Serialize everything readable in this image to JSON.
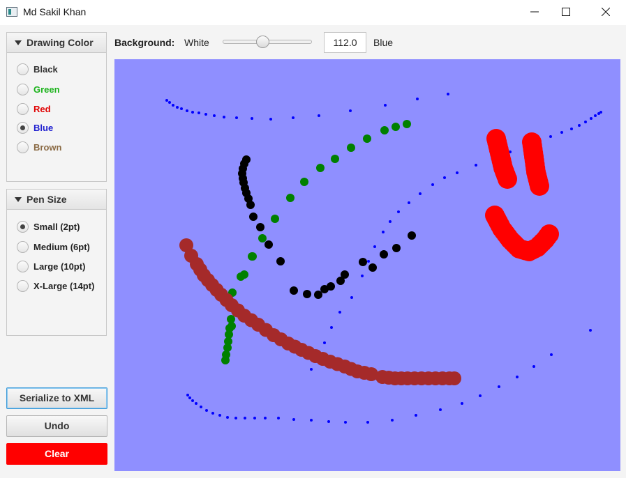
{
  "window": {
    "title": "Md Sakil Khan"
  },
  "color_panel": {
    "title": "Drawing Color",
    "options": [
      {
        "label": "Black",
        "color": "#333333",
        "selected": false
      },
      {
        "label": "Green",
        "color": "#1db31d",
        "selected": false
      },
      {
        "label": "Red",
        "color": "#e00000",
        "selected": false
      },
      {
        "label": "Blue",
        "color": "#2020d0",
        "selected": true
      },
      {
        "label": "Brown",
        "color": "#8a6a44",
        "selected": false
      }
    ]
  },
  "pen_panel": {
    "title": "Pen Size",
    "options": [
      {
        "label": "Small (2pt)",
        "selected": true
      },
      {
        "label": "Medium (6pt)",
        "selected": false
      },
      {
        "label": "Large (10pt)",
        "selected": false
      },
      {
        "label": "X-Large (14pt)",
        "selected": false
      }
    ]
  },
  "buttons": {
    "serialize": "Serialize to XML",
    "undo": "Undo",
    "clear": "Clear"
  },
  "background": {
    "label": "Background:",
    "min_label": "White",
    "max_label": "Blue",
    "value": "112.0",
    "slider_fraction": 0.44,
    "canvas_color": "#8f8fff"
  },
  "colors": {
    "blue_dot": "#0000ff",
    "green_dot": "#008000",
    "black_dot": "#000000",
    "brown_dot": "#a52a2a",
    "red_dot": "#ff0000"
  }
}
